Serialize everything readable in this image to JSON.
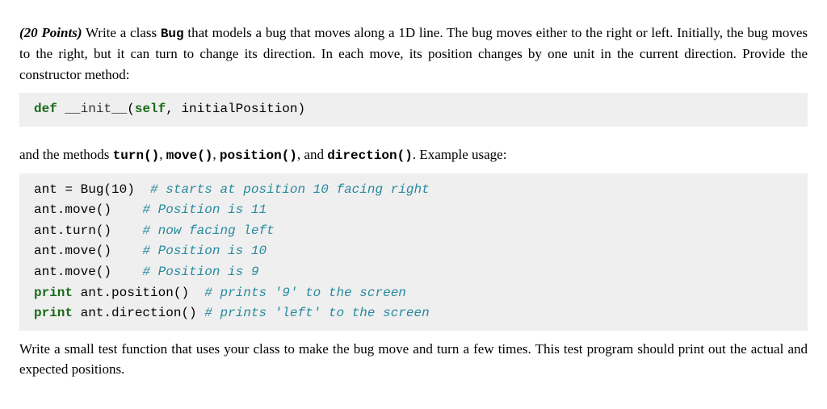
{
  "para1": {
    "points": "(20 Points)",
    "text_a": " Write a class ",
    "class": "Bug",
    "text_b": " that models a bug that moves along a 1D line. The bug moves either to the right or left. Initially, the bug moves to the right, but it can turn to change its direction. In each move, its position changes by one unit in the current direction. Provide the constructor method:"
  },
  "code1": {
    "kw": "def",
    "space": " ",
    "fn": "__init__",
    "sig_a": "(",
    "self": "self",
    "sig_b": ", initialPosition)"
  },
  "para2": {
    "a": "and the methods ",
    "m1": "turn()",
    "c1": ", ",
    "m2": "move()",
    "c2": ", ",
    "m3": "position()",
    "c3": ", and ",
    "m4": "direction()",
    "d": ". Example usage:"
  },
  "code2": {
    "l1_a": "ant = Bug(10)  ",
    "l1_c": "# starts at position 10 facing right",
    "l2_a": "ant.move()    ",
    "l2_c": "# Position is 11",
    "l3_a": "ant.turn()    ",
    "l3_c": "# now facing left",
    "l4_a": "ant.move()    ",
    "l4_c": "# Position is 10",
    "l5_a": "ant.move()    ",
    "l5_c": "# Position is 9",
    "l6_kw": "print",
    "l6_a": " ant.position()  ",
    "l6_c": "# prints '9' to the screen",
    "l7_kw": "print",
    "l7_a": " ant.direction() ",
    "l7_c": "# prints 'left' to the screen"
  },
  "para3": "Write a small test function that uses your class to make the bug move and turn a few times. This test program should print out the actual and expected positions."
}
